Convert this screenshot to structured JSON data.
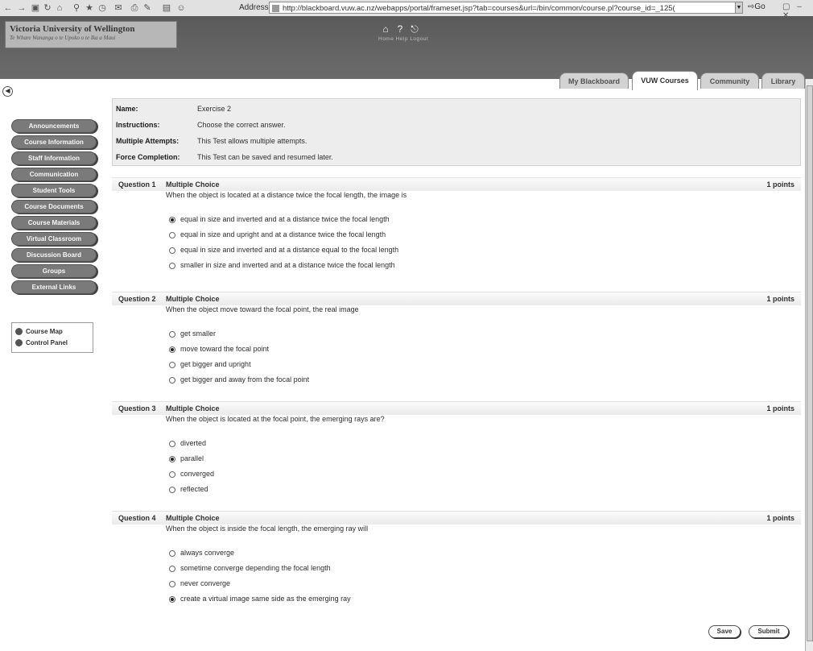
{
  "browser": {
    "address_label": "Address",
    "url": "http://blackboard.vuw.ac.nz/webapps/portal/frameset.jsp?tab=courses&url=/bin/common/course.pl?course_id=_125(",
    "go_label": "Go"
  },
  "header": {
    "university_name": "Victoria University of Wellington",
    "motto": "Te Whare Wananga o te Upoko o te Ika a Maui",
    "top_links": "Home   Help   Logout",
    "tabs": [
      {
        "label": "My Blackboard",
        "active": false
      },
      {
        "label": "VUW Courses",
        "active": true
      },
      {
        "label": "Community",
        "active": false
      },
      {
        "label": "Library",
        "active": false
      }
    ]
  },
  "nav": {
    "items": [
      "Announcements",
      "Course Information",
      "Staff Information",
      "Communication",
      "Student Tools",
      "Course Documents",
      "Course Materials",
      "Virtual Classroom",
      "Discussion Board",
      "Groups",
      "External Links"
    ],
    "tools": [
      "Course Map",
      "Control Panel"
    ]
  },
  "test_info": {
    "rows": [
      {
        "key": "Name:",
        "value": "Exercise 2"
      },
      {
        "key": "Instructions:",
        "value": "Choose the correct answer."
      },
      {
        "key": "Multiple Attempts:",
        "value": "This Test allows multiple attempts."
      },
      {
        "key": "Force Completion:",
        "value": "This Test can be saved and resumed later."
      }
    ]
  },
  "questions": [
    {
      "number": "Question 1",
      "type": "Multiple Choice",
      "points": "1 points",
      "text": "When the object is located at a distance twice the focal length, the image is",
      "options": [
        {
          "label": "equal in size and inverted and at a distance twice the focal length",
          "selected": true
        },
        {
          "label": "equal in size and upright and at a distance twice the focal length",
          "selected": false
        },
        {
          "label": "equal in size and inverted and at a distance equal to the focal length",
          "selected": false
        },
        {
          "label": "smaller in size and inverted and at a distance twice the focal length",
          "selected": false
        }
      ]
    },
    {
      "number": "Question 2",
      "type": "Multiple Choice",
      "points": "1 points",
      "text": "When the object move toward the focal point, the real image",
      "options": [
        {
          "label": "get smaller",
          "selected": false
        },
        {
          "label": "move toward the focal point",
          "selected": true
        },
        {
          "label": "get bigger and upright",
          "selected": false
        },
        {
          "label": "get bigger and away from the focal point",
          "selected": false
        }
      ]
    },
    {
      "number": "Question 3",
      "type": "Multiple Choice",
      "points": "1 points",
      "text": "When the object is located at the focal point, the emerging rays are?",
      "options": [
        {
          "label": "diverted",
          "selected": false
        },
        {
          "label": "parallel",
          "selected": true
        },
        {
          "label": "converged",
          "selected": false
        },
        {
          "label": "reflected",
          "selected": false
        }
      ]
    },
    {
      "number": "Question 4",
      "type": "Multiple Choice",
      "points": "1 points",
      "text": "When the object is inside the focal length, the emerging ray will",
      "options": [
        {
          "label": "always converge",
          "selected": false
        },
        {
          "label": "sometime converge depending the focal length",
          "selected": false
        },
        {
          "label": "never converge",
          "selected": false
        },
        {
          "label": "create a virtual image same side as the emerging ray",
          "selected": true
        }
      ]
    }
  ],
  "actions": {
    "save_label": "Save",
    "submit_label": "Submit"
  }
}
